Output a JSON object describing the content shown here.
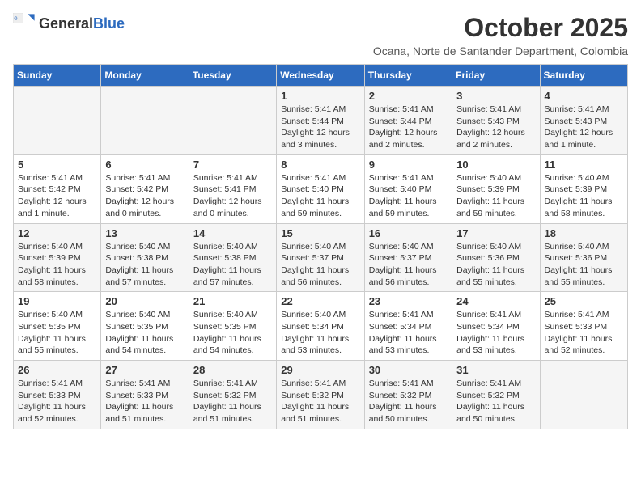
{
  "header": {
    "logo_general": "General",
    "logo_blue": "Blue",
    "month_title": "October 2025",
    "subtitle": "Ocana, Norte de Santander Department, Colombia"
  },
  "days_of_week": [
    "Sunday",
    "Monday",
    "Tuesday",
    "Wednesday",
    "Thursday",
    "Friday",
    "Saturday"
  ],
  "weeks": [
    [
      {
        "day": "",
        "content": ""
      },
      {
        "day": "",
        "content": ""
      },
      {
        "day": "",
        "content": ""
      },
      {
        "day": "1",
        "content": "Sunrise: 5:41 AM\nSunset: 5:44 PM\nDaylight: 12 hours and 3 minutes."
      },
      {
        "day": "2",
        "content": "Sunrise: 5:41 AM\nSunset: 5:44 PM\nDaylight: 12 hours and 2 minutes."
      },
      {
        "day": "3",
        "content": "Sunrise: 5:41 AM\nSunset: 5:43 PM\nDaylight: 12 hours and 2 minutes."
      },
      {
        "day": "4",
        "content": "Sunrise: 5:41 AM\nSunset: 5:43 PM\nDaylight: 12 hours and 1 minute."
      }
    ],
    [
      {
        "day": "5",
        "content": "Sunrise: 5:41 AM\nSunset: 5:42 PM\nDaylight: 12 hours and 1 minute."
      },
      {
        "day": "6",
        "content": "Sunrise: 5:41 AM\nSunset: 5:42 PM\nDaylight: 12 hours and 0 minutes."
      },
      {
        "day": "7",
        "content": "Sunrise: 5:41 AM\nSunset: 5:41 PM\nDaylight: 12 hours and 0 minutes."
      },
      {
        "day": "8",
        "content": "Sunrise: 5:41 AM\nSunset: 5:40 PM\nDaylight: 11 hours and 59 minutes."
      },
      {
        "day": "9",
        "content": "Sunrise: 5:41 AM\nSunset: 5:40 PM\nDaylight: 11 hours and 59 minutes."
      },
      {
        "day": "10",
        "content": "Sunrise: 5:40 AM\nSunset: 5:39 PM\nDaylight: 11 hours and 59 minutes."
      },
      {
        "day": "11",
        "content": "Sunrise: 5:40 AM\nSunset: 5:39 PM\nDaylight: 11 hours and 58 minutes."
      }
    ],
    [
      {
        "day": "12",
        "content": "Sunrise: 5:40 AM\nSunset: 5:39 PM\nDaylight: 11 hours and 58 minutes."
      },
      {
        "day": "13",
        "content": "Sunrise: 5:40 AM\nSunset: 5:38 PM\nDaylight: 11 hours and 57 minutes."
      },
      {
        "day": "14",
        "content": "Sunrise: 5:40 AM\nSunset: 5:38 PM\nDaylight: 11 hours and 57 minutes."
      },
      {
        "day": "15",
        "content": "Sunrise: 5:40 AM\nSunset: 5:37 PM\nDaylight: 11 hours and 56 minutes."
      },
      {
        "day": "16",
        "content": "Sunrise: 5:40 AM\nSunset: 5:37 PM\nDaylight: 11 hours and 56 minutes."
      },
      {
        "day": "17",
        "content": "Sunrise: 5:40 AM\nSunset: 5:36 PM\nDaylight: 11 hours and 55 minutes."
      },
      {
        "day": "18",
        "content": "Sunrise: 5:40 AM\nSunset: 5:36 PM\nDaylight: 11 hours and 55 minutes."
      }
    ],
    [
      {
        "day": "19",
        "content": "Sunrise: 5:40 AM\nSunset: 5:35 PM\nDaylight: 11 hours and 55 minutes."
      },
      {
        "day": "20",
        "content": "Sunrise: 5:40 AM\nSunset: 5:35 PM\nDaylight: 11 hours and 54 minutes."
      },
      {
        "day": "21",
        "content": "Sunrise: 5:40 AM\nSunset: 5:35 PM\nDaylight: 11 hours and 54 minutes."
      },
      {
        "day": "22",
        "content": "Sunrise: 5:40 AM\nSunset: 5:34 PM\nDaylight: 11 hours and 53 minutes."
      },
      {
        "day": "23",
        "content": "Sunrise: 5:41 AM\nSunset: 5:34 PM\nDaylight: 11 hours and 53 minutes."
      },
      {
        "day": "24",
        "content": "Sunrise: 5:41 AM\nSunset: 5:34 PM\nDaylight: 11 hours and 53 minutes."
      },
      {
        "day": "25",
        "content": "Sunrise: 5:41 AM\nSunset: 5:33 PM\nDaylight: 11 hours and 52 minutes."
      }
    ],
    [
      {
        "day": "26",
        "content": "Sunrise: 5:41 AM\nSunset: 5:33 PM\nDaylight: 11 hours and 52 minutes."
      },
      {
        "day": "27",
        "content": "Sunrise: 5:41 AM\nSunset: 5:33 PM\nDaylight: 11 hours and 51 minutes."
      },
      {
        "day": "28",
        "content": "Sunrise: 5:41 AM\nSunset: 5:32 PM\nDaylight: 11 hours and 51 minutes."
      },
      {
        "day": "29",
        "content": "Sunrise: 5:41 AM\nSunset: 5:32 PM\nDaylight: 11 hours and 51 minutes."
      },
      {
        "day": "30",
        "content": "Sunrise: 5:41 AM\nSunset: 5:32 PM\nDaylight: 11 hours and 50 minutes."
      },
      {
        "day": "31",
        "content": "Sunrise: 5:41 AM\nSunset: 5:32 PM\nDaylight: 11 hours and 50 minutes."
      },
      {
        "day": "",
        "content": ""
      }
    ]
  ]
}
